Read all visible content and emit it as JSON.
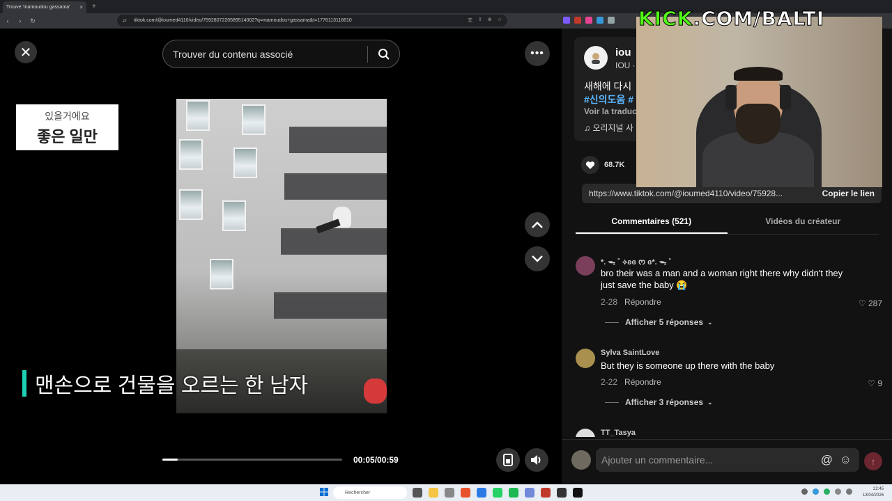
{
  "browser": {
    "tab_title": "Trouve 'mamoudou gassama'",
    "tab_close": "×",
    "new_tab": "+",
    "url": "tiktok.com/@ioumed4110/video/7592807220589514002?q=mamoudou+gassama&t=1776113116610"
  },
  "video_header": {
    "search_placeholder": "Trouver du contenu associé",
    "close_label": "✕",
    "more_label": "•••"
  },
  "video": {
    "caption_line1": "있을거에요",
    "caption_line2": "좋은 일만",
    "subtitle": "맨손으로 건물을 오르는 한 남자",
    "time": "00:05/00:59",
    "progress_fraction": 0.085
  },
  "panel": {
    "author_name": "iou",
    "author_sub": "IOU ·",
    "description": "새해에 다시",
    "hashtags": "#신의도움 #",
    "translate": "Voir la traduc",
    "music": "♫ 오리지널 사",
    "likes": "68.7K",
    "link_url": "https://www.tiktok.com/@ioumed4110/video/75928...",
    "copy_label": "Copier le lien",
    "tab_comments": "Commentaires (521)",
    "tab_creator": "Vidéos du créateur",
    "compose_placeholder": "Ajouter un commentaire...",
    "at_label": "@",
    "emoji_label": "☺",
    "send_label": "↑"
  },
  "comments": [
    {
      "user": "*. ᯓ ˚ ⟡ʚɞ ᰔ ɞ*. ᯓ ˚",
      "text": "bro their was a man and a woman right there why didn't they just save the baby 😭",
      "date": "2-28",
      "reply": "Répondre",
      "likes": "287",
      "replies": "Afficher 5 réponses",
      "avatar_color": "#7a3f5a"
    },
    {
      "user": "Sylva SaintLove",
      "text": "But they is someone up there with the baby",
      "date": "2-22",
      "reply": "Répondre",
      "likes": "9",
      "replies": "Afficher 3 réponses",
      "avatar_color": "#a9904f"
    },
    {
      "user": "TT_Tasya",
      "text": "",
      "date": "",
      "reply": "",
      "likes": "",
      "replies": "",
      "avatar_color": "#ddd"
    }
  ],
  "overlay": {
    "kick_part1": "KICK",
    "kick_part2": ".COM/BALTI"
  },
  "taskbar": {
    "search": "Rechercher",
    "time": "22:45",
    "date": "13/04/2026"
  },
  "colors": {
    "accent_kick": "#53fc18",
    "hashtag": "#5bb7ff",
    "subtitle_bar": "#1dd1b2"
  }
}
